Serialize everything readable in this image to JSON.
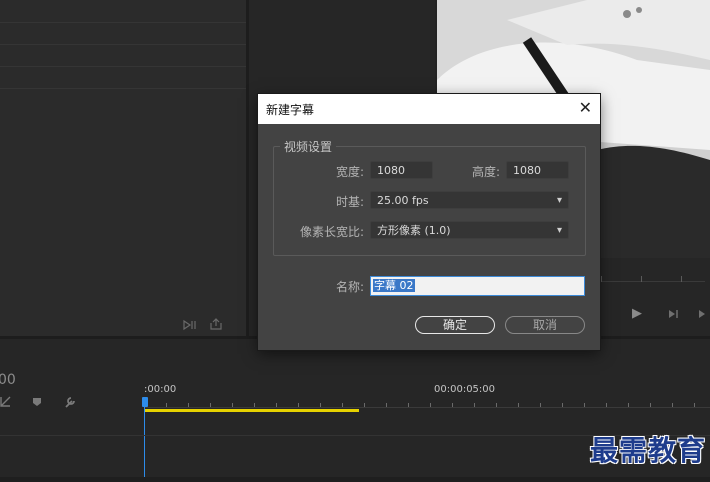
{
  "dialog": {
    "title": "新建字幕",
    "close_glyph": "✕",
    "video_settings": {
      "group_label": "视频设置",
      "width_label": "宽度:",
      "width_value": "1080",
      "height_label": "高度:",
      "height_value": "1080",
      "timebase_label": "时基:",
      "timebase_value": "25.00 fps",
      "pixel_aspect_label": "像素长宽比:",
      "pixel_aspect_value": "方形像素 (1.0)"
    },
    "name_label": "名称:",
    "name_value": "字幕 02",
    "ok_label": "确定",
    "cancel_label": "取消"
  },
  "timeline": {
    "timecode_partial": "00",
    "ruler_start": ":00:00",
    "ruler_mark": "00:00:05:00"
  },
  "watermark": "最需教育",
  "colors": {
    "accent_blue": "#3c8ad8",
    "work_area_yellow": "#e6d200",
    "playhead_blue": "#2d8ceb",
    "watermark_blue": "#1e3c8c"
  },
  "icons": {
    "dropdown": "▾",
    "play": "▶"
  }
}
